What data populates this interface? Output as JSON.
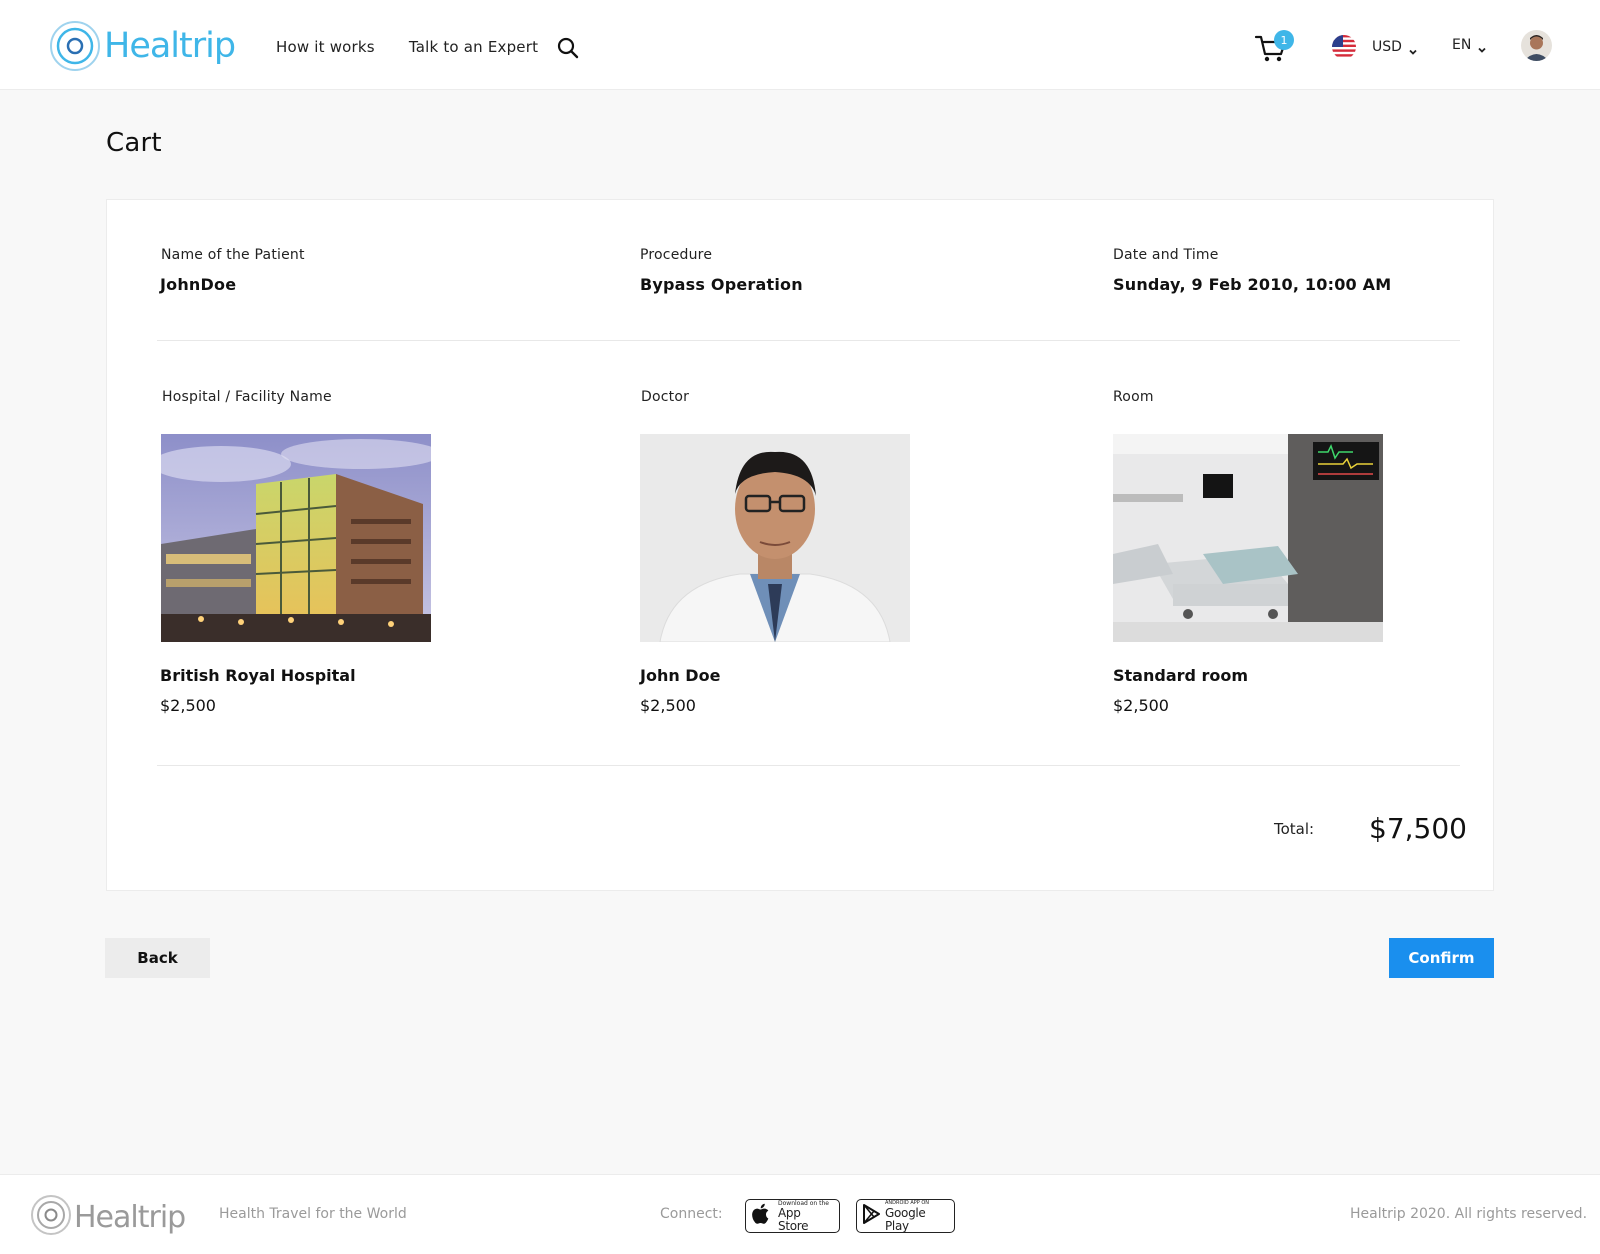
{
  "brand": {
    "name": "Healtrip",
    "accent": "#3fb6e8"
  },
  "nav": [
    {
      "label": "How it works"
    },
    {
      "label": "Talk to an Expert"
    }
  ],
  "cart": {
    "count": "1"
  },
  "currency": {
    "label": "USD"
  },
  "language": {
    "label": "EN"
  },
  "page": {
    "title": "Cart"
  },
  "booking": {
    "patient": {
      "label": "Name of the Patient",
      "value": "JohnDoe"
    },
    "procedure": {
      "label": "Procedure",
      "value": "Bypass Operation"
    },
    "datetime": {
      "label": "Date and Time",
      "value": "Sunday, 9 Feb 2010, 10:00 AM"
    }
  },
  "items": {
    "hospital": {
      "label": "Hospital / Facility Name",
      "name": "British Royal Hospital",
      "price": "$2,500"
    },
    "doctor": {
      "label": "Doctor",
      "name": "John Doe",
      "price": "$2,500"
    },
    "room": {
      "label": "Room",
      "name": "Standard room",
      "price": "$2,500"
    }
  },
  "total": {
    "label": "Total:",
    "value": "$7,500"
  },
  "actions": {
    "back": "Back",
    "confirm": "Confirm",
    "confirm_color": "#1a8fee"
  },
  "footer": {
    "brand": "Healtrip",
    "tagline": "Health Travel for the World",
    "connect": "Connect:",
    "appstore_small": "Download on the",
    "appstore_big": "App Store",
    "gplay_small": "ANDROID APP ON",
    "gplay_big": "Google Play",
    "copyright": "Healtrip 2020. All rights reserved."
  }
}
